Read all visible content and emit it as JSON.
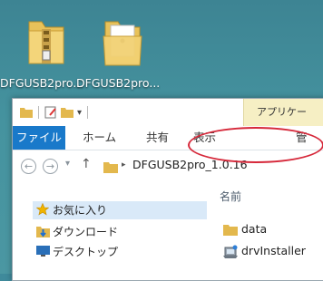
{
  "desktop": {
    "icons": [
      {
        "label": "DFGUSB2pro...",
        "icon": "zip-folder-icon"
      },
      {
        "label": "DFGUSB2pro...",
        "icon": "folder-icon"
      }
    ]
  },
  "window": {
    "context_tab": "アプリケー",
    "ribbon_tabs": [
      "ファイル",
      "ホーム",
      "共有",
      "表示",
      "管"
    ],
    "address": {
      "path": [
        "DFGUSB2pro_1.0.16"
      ]
    },
    "navigation": [
      {
        "label": "お気に入り",
        "icon": "star-icon"
      },
      {
        "label": "ダウンロード",
        "icon": "downloads-icon"
      },
      {
        "label": "デスクトップ",
        "icon": "desktop-icon"
      }
    ],
    "file_list": {
      "column": "名前",
      "items": [
        {
          "name": "data",
          "icon": "folder-icon"
        },
        {
          "name": "drvInstaller",
          "icon": "installer-icon"
        }
      ]
    }
  },
  "colors": {
    "desktop": "#45939f",
    "file_tab": "#1979ca",
    "highlight": "#d6283a",
    "context_tab": "#f6efc4"
  }
}
